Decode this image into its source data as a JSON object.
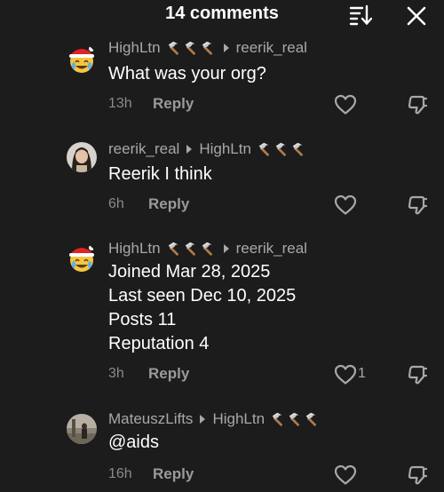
{
  "header": {
    "title": "14 comments",
    "sort_icon": "sort-icon",
    "close_icon": "close-icon"
  },
  "comments": [
    {
      "author": "HighLtn",
      "badge": "hammer-icons",
      "reply_to": "reerik_real",
      "avatar": "santa-hat-emoji-avatar",
      "lines": [
        "What was your org?"
      ],
      "time": "13h",
      "reply_label": "Reply",
      "likes": ""
    },
    {
      "author": "reerik_real",
      "reply_to": "HighLtn",
      "reply_to_badge": "hammer-icons",
      "avatar": "photo-avatar",
      "lines": [
        "Reerik I think"
      ],
      "time": "6h",
      "reply_label": "Reply",
      "likes": ""
    },
    {
      "author": "HighLtn",
      "badge": "hammer-icons",
      "reply_to": "reerik_real",
      "avatar": "santa-hat-emoji-avatar",
      "lines": [
        "Joined Mar 28, 2025",
        "Last seen Dec 10, 2025",
        "Posts 11",
        "Reputation 4"
      ],
      "time": "3h",
      "reply_label": "Reply",
      "likes": "1"
    },
    {
      "author": "MateuszLifts",
      "reply_to": "HighLtn",
      "reply_to_badge": "hammer-icons",
      "avatar": "photo-avatar",
      "lines": [
        "@aids"
      ],
      "time": "16h",
      "reply_label": "Reply",
      "likes": ""
    }
  ],
  "colors": {
    "background": "#1c1c1c",
    "meta_text": "#a8a8a8",
    "body_text": "#ffffff"
  }
}
